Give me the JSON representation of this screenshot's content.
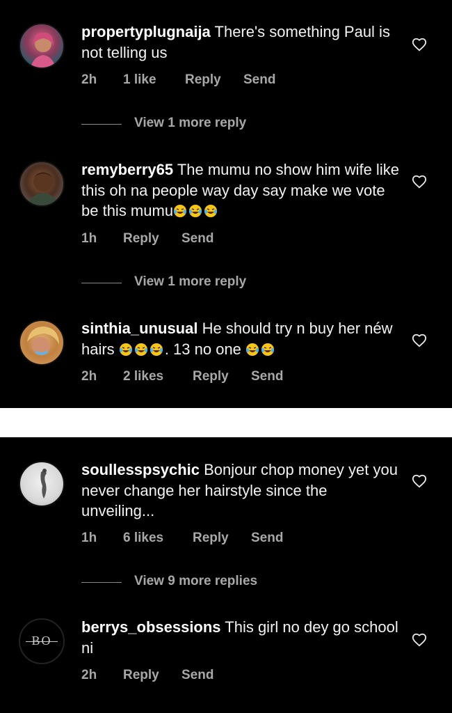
{
  "comments": [
    {
      "username": "propertyplugnaija",
      "text": "There's something Paul is not telling us",
      "time": "2h",
      "likes": "1 like",
      "reply": "Reply",
      "send": "Send",
      "view_more": "View 1 more reply"
    },
    {
      "username": "remyberry65",
      "text": "The mumu no show him wife like this oh na people way day say make we vote be this mumu",
      "emoji_suffix": "😂😂😂",
      "time": "1h",
      "reply": "Reply",
      "send": "Send",
      "view_more": "View 1 more reply"
    },
    {
      "username": "sinthia_unusual",
      "text_part1": "He should try n buy her néw hairs",
      "emoji_mid": "😂😂😂",
      "text_part2": ". 13 no one",
      "emoji_end": "😂😂",
      "time": "2h",
      "likes": "2 likes",
      "reply": "Reply",
      "send": "Send"
    },
    {
      "username": "soullesspsychic",
      "text": "Bonjour chop money yet you never change her hairstyle since the unveiling...",
      "time": "1h",
      "likes": "6 likes",
      "reply": "Reply",
      "send": "Send",
      "view_more": "View 9 more replies"
    },
    {
      "username": "berrys_obsessions",
      "text": "This girl no dey go school ni",
      "avatar_text": "BO",
      "time": "2h",
      "reply": "Reply",
      "send": "Send"
    }
  ],
  "icons": {
    "like": "heart-outline-icon",
    "emoji": "laughing-tears-emoji"
  },
  "colors": {
    "background": "#000000",
    "divider": "#ffffff",
    "secondary_text": "#a8a8a8"
  }
}
